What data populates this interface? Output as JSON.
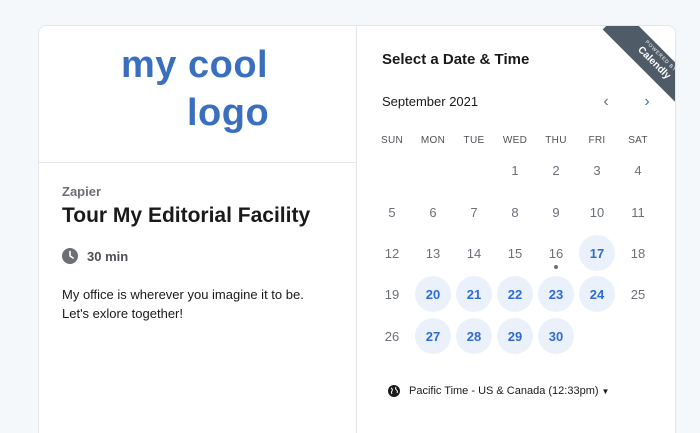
{
  "logo": {
    "line1": "my cool",
    "line2": "logo"
  },
  "event": {
    "organizer": "Zapier",
    "title": "Tour My Editorial Facility",
    "duration": "30 min",
    "description": "My office is wherever you imagine it to be. Let's exlore together!"
  },
  "calendar": {
    "heading": "Select a Date & Time",
    "month": "September 2021",
    "weekdays": [
      "SUN",
      "MON",
      "TUE",
      "WED",
      "THU",
      "FRI",
      "SAT"
    ],
    "days": [
      {
        "label": "1",
        "available": false
      },
      {
        "label": "2",
        "available": false
      },
      {
        "label": "3",
        "available": false
      },
      {
        "label": "4",
        "available": false
      },
      {
        "label": "5",
        "available": false
      },
      {
        "label": "6",
        "available": false
      },
      {
        "label": "7",
        "available": false
      },
      {
        "label": "8",
        "available": false
      },
      {
        "label": "9",
        "available": false
      },
      {
        "label": "10",
        "available": false
      },
      {
        "label": "11",
        "available": false
      },
      {
        "label": "12",
        "available": false
      },
      {
        "label": "13",
        "available": false
      },
      {
        "label": "14",
        "available": false
      },
      {
        "label": "15",
        "available": false
      },
      {
        "label": "16",
        "available": false,
        "today": true
      },
      {
        "label": "17",
        "available": true
      },
      {
        "label": "18",
        "available": false
      },
      {
        "label": "19",
        "available": false
      },
      {
        "label": "20",
        "available": true
      },
      {
        "label": "21",
        "available": true
      },
      {
        "label": "22",
        "available": true
      },
      {
        "label": "23",
        "available": true
      },
      {
        "label": "24",
        "available": true
      },
      {
        "label": "25",
        "available": false
      },
      {
        "label": "26",
        "available": false
      },
      {
        "label": "27",
        "available": true
      },
      {
        "label": "28",
        "available": true
      },
      {
        "label": "29",
        "available": true
      },
      {
        "label": "30",
        "available": true
      }
    ],
    "timezone": "Pacific Time - US & Canada (12:33pm)"
  },
  "badge": {
    "small": "POWERED BY",
    "brand": "Calendly"
  },
  "colors": {
    "accent": "#2f6bd0",
    "available_bg": "#eaf1fb",
    "logo": "#3a6fbf",
    "ribbon": "#4f5b66"
  },
  "icons": {
    "clock": "clock-icon",
    "globe": "globe-icon",
    "prev": "chevron-left-icon",
    "next": "chevron-right-icon",
    "caret": "caret-down-icon"
  }
}
